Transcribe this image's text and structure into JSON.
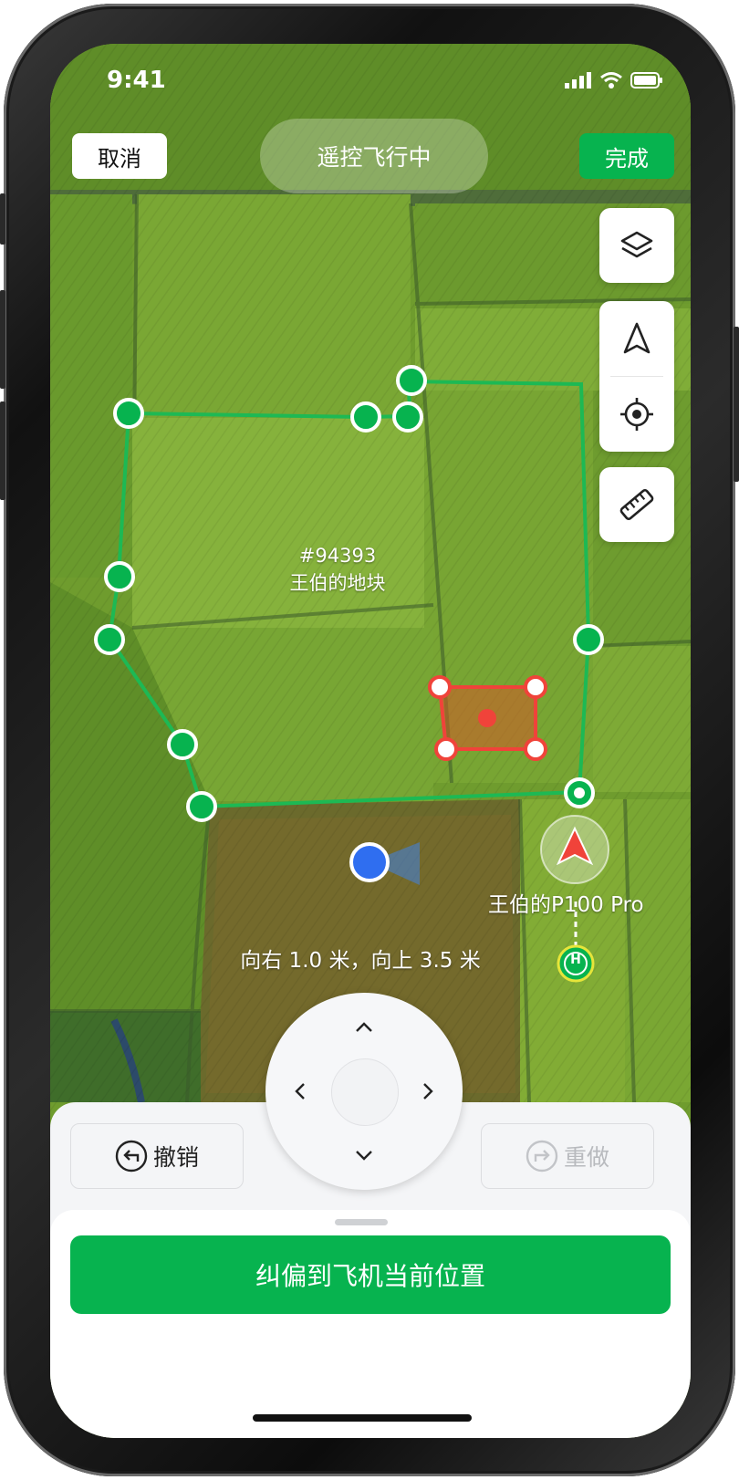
{
  "status_bar": {
    "time": "9:41"
  },
  "header": {
    "cancel_label": "取消",
    "status": "遥控飞行中",
    "done_label": "完成"
  },
  "toolbar": {
    "icons": [
      "layers-icon",
      "navigation-arrow-icon",
      "locate-target-icon",
      "ruler-icon"
    ]
  },
  "map": {
    "plot_id": "#94393",
    "plot_name": "王伯的地块",
    "drone_name": "王伯的P100 Pro",
    "offset_text": "向右 1.0 米，向上 3.5 米",
    "home_marker": "H"
  },
  "controls": {
    "undo_label": "撤销",
    "redo_label": "重做",
    "primary_action": "纠偏到飞机当前位置"
  },
  "colors": {
    "accent": "#07b34f",
    "obstacle": "#f0433a",
    "position_dot": "#2f6ef0"
  }
}
